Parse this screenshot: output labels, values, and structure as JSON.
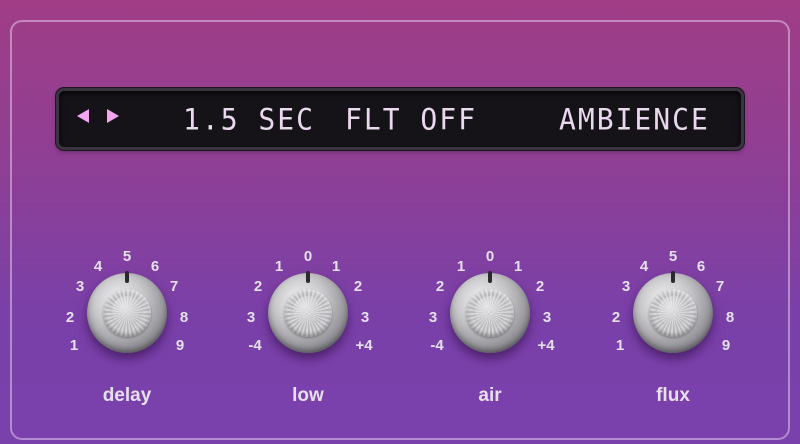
{
  "display": {
    "time": "1.5 SEC",
    "filter": "FLT OFF",
    "preset": "AMBIENCE",
    "prev_icon": "triangle-left-icon",
    "next_icon": "triangle-right-icon"
  },
  "knobs": [
    {
      "label": "delay",
      "scale": [
        "1",
        "2",
        "3",
        "4",
        "5",
        "6",
        "7",
        "8",
        "9"
      ]
    },
    {
      "label": "low",
      "scale": [
        "-4",
        "3",
        "2",
        "1",
        "0",
        "1",
        "2",
        "3",
        "+4"
      ]
    },
    {
      "label": "air",
      "scale": [
        "-4",
        "3",
        "2",
        "1",
        "0",
        "1",
        "2",
        "3",
        "+4"
      ]
    },
    {
      "label": "flux",
      "scale": [
        "1",
        "2",
        "3",
        "4",
        "5",
        "6",
        "7",
        "8",
        "9"
      ]
    }
  ],
  "colors": {
    "accent": "#f2a6f0",
    "lcd_text": "#e9d9ec",
    "background_top": "#a03d86",
    "background_bottom": "#7a41ad"
  }
}
